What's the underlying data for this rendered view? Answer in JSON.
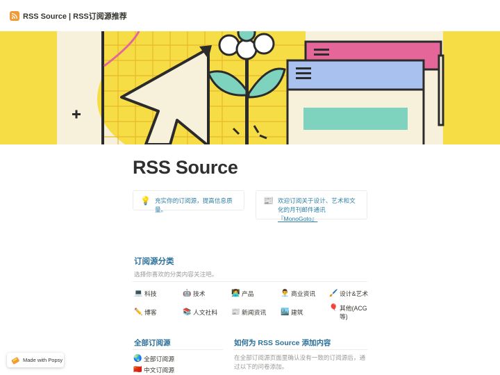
{
  "header": {
    "title": "RSS Source | RSS订阅源推荐",
    "icon": "rss-icon"
  },
  "cover": {
    "description_icon": "cover-illustration"
  },
  "page": {
    "title": "RSS Source"
  },
  "callouts": [
    {
      "icon": "💡",
      "text": "充实你的订阅源，提高信息质量。"
    },
    {
      "icon": "📰",
      "text": "欢迎订阅关于设计、艺术和文化的月刊邮件通讯",
      "link": "『MonoGoto』"
    }
  ],
  "categories_section": {
    "title": "订阅源分类",
    "subtitle": "选择你喜欢的分类内容关注吧。",
    "items": [
      {
        "emoji": "💻",
        "label": "科技"
      },
      {
        "emoji": "🤖",
        "label": "技术"
      },
      {
        "emoji": "👩‍💻",
        "label": "产品"
      },
      {
        "emoji": "👨‍💼",
        "label": "商业资讯"
      },
      {
        "emoji": "🖌️",
        "label": "设计&艺术"
      },
      {
        "emoji": "✏️",
        "label": "博客"
      },
      {
        "emoji": "📚",
        "label": "人文社科"
      },
      {
        "emoji": "📰",
        "label": "新闻资讯"
      },
      {
        "emoji": "🏙️",
        "label": "建筑"
      },
      {
        "emoji": "🎈",
        "label": "其他(ACG等)"
      }
    ]
  },
  "all_feeds": {
    "title": "全部订阅源",
    "items": [
      {
        "emoji": "🌏",
        "label": "全部订阅源"
      },
      {
        "emoji": "🇨🇳",
        "label": "中文订阅源"
      }
    ]
  },
  "how_to_add": {
    "title": "如何为 RSS Source 添加内容",
    "text": "在全部订阅源页面里确认没有一致的订阅源后，通过以下的问卷添加。"
  },
  "badge": {
    "label": "Made with Popsy"
  },
  "colors": {
    "cover_yellow": "#f6dd45",
    "accent_blue": "#2a6f99",
    "link_blue": "#2e7fa6",
    "rss_orange": "#f19a37"
  }
}
